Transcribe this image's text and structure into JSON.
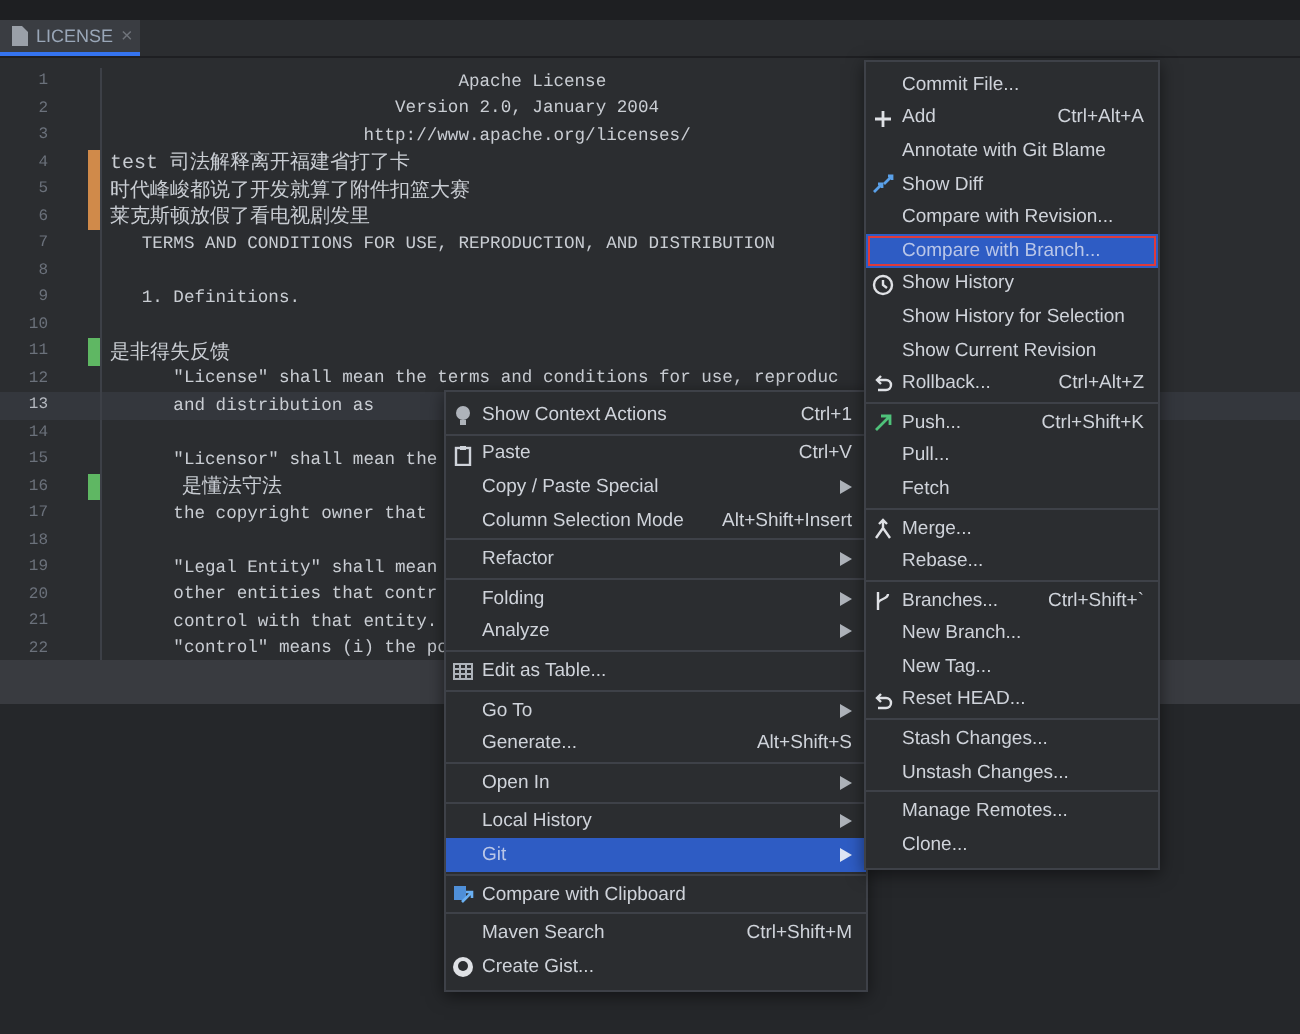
{
  "tab": {
    "label": "LICENSE",
    "close": "×",
    "selected": true
  },
  "editor": {
    "lines": [
      {
        "number": "1",
        "text": "                                 Apache License"
      },
      {
        "number": "2",
        "text": "                           Version 2.0, January 2004"
      },
      {
        "number": "3",
        "text": "                        http://www.apache.org/licenses/"
      },
      {
        "number": "4",
        "text": "test 司法解释离开福建省打了卡",
        "color": "#d08a4a"
      },
      {
        "number": "5",
        "text": "时代峰峻都说了开发就算了附件扣篮大赛",
        "color": "#d08a4a"
      },
      {
        "number": "6",
        "text": "莱克斯顿放假了看电视剧发里",
        "color": "#d08a4a"
      },
      {
        "number": "7",
        "text": "   TERMS AND CONDITIONS FOR USE, REPRODUCTION, AND DISTRIBUTION"
      },
      {
        "number": "8"
      },
      {
        "number": "9",
        "text": "   1. Definitions."
      },
      {
        "number": "10"
      },
      {
        "number": "11",
        "text": "是非得失反馈",
        "color": "#5fb763"
      },
      {
        "number": "12",
        "text": "      \"License\" shall mean the terms and conditions for use, reproduc"
      },
      {
        "number": "13",
        "text": "      and distribution as",
        "current": true
      },
      {
        "number": "14"
      },
      {
        "number": "15",
        "text": "      \"Licensor\" shall mean the"
      },
      {
        "number": "16",
        "text": "      是懂法守法",
        "color": "#5fb763"
      },
      {
        "number": "17",
        "text": "      the copyright owner that"
      },
      {
        "number": "18"
      },
      {
        "number": "19",
        "text": "      \"Legal Entity\" shall mean"
      },
      {
        "number": "20",
        "text": "      other entities that contr"
      },
      {
        "number": "21",
        "text": "      control with that entity."
      },
      {
        "number": "22",
        "text": "      \"control\" means (i) the po"
      }
    ]
  },
  "context_menu": {
    "items": [
      {
        "kind": "item",
        "label": "Show Context Actions",
        "shortcut": "Ctrl+1",
        "selected": false
      },
      {
        "kind": "separator"
      },
      {
        "kind": "item",
        "label": "Paste",
        "shortcut": "Ctrl+V",
        "selected": false
      },
      {
        "kind": "item",
        "label": "Copy / Paste Special",
        "submenu": true,
        "selected": false
      },
      {
        "kind": "item",
        "label": "Column Selection Mode",
        "shortcut": "Alt+Shift+Insert",
        "selected": false
      },
      {
        "kind": "separator"
      },
      {
        "kind": "item",
        "label": "Refactor",
        "submenu": true,
        "selected": false
      },
      {
        "kind": "separator"
      },
      {
        "kind": "item",
        "label": "Folding",
        "submenu": true,
        "selected": false
      },
      {
        "kind": "item",
        "label": "Analyze",
        "submenu": true,
        "selected": false
      },
      {
        "kind": "separator"
      },
      {
        "kind": "item",
        "label": "Edit as Table...",
        "selected": false
      },
      {
        "kind": "separator"
      },
      {
        "kind": "item",
        "label": "Go To",
        "submenu": true,
        "selected": false
      },
      {
        "kind": "item",
        "label": "Generate...",
        "shortcut": "Alt+Shift+S",
        "selected": false
      },
      {
        "kind": "separator"
      },
      {
        "kind": "item",
        "label": "Open In",
        "submenu": true,
        "selected": false
      },
      {
        "kind": "separator"
      },
      {
        "kind": "item",
        "label": "Local History",
        "submenu": true,
        "selected": false
      },
      {
        "kind": "item",
        "label": "Git",
        "submenu": true,
        "selected": true
      },
      {
        "kind": "separator"
      },
      {
        "kind": "item",
        "label": "Compare with Clipboard",
        "selected": false
      },
      {
        "kind": "separator"
      },
      {
        "kind": "item",
        "label": "Maven Search",
        "shortcut": "Ctrl+Shift+M",
        "selected": false
      },
      {
        "kind": "item",
        "label": "Create Gist...",
        "selected": false
      }
    ]
  },
  "git_submenu": {
    "items": [
      {
        "kind": "item",
        "label": "Commit File...",
        "selected": false
      },
      {
        "kind": "item",
        "label": "Add",
        "shortcut": "Ctrl+Alt+A",
        "selected": false
      },
      {
        "kind": "item",
        "label": "Annotate with Git Blame",
        "selected": false
      },
      {
        "kind": "item",
        "label": "Show Diff",
        "selected": false
      },
      {
        "kind": "item",
        "label": "Compare with Revision...",
        "selected": false
      },
      {
        "kind": "item",
        "label": "Compare with Branch...",
        "selected": true,
        "outlined": true
      },
      {
        "kind": "item",
        "label": "Show History",
        "selected": false
      },
      {
        "kind": "item",
        "label": "Show History for Selection",
        "selected": false
      },
      {
        "kind": "item",
        "label": "Show Current Revision",
        "selected": false
      },
      {
        "kind": "item",
        "label": "Rollback...",
        "shortcut": "Ctrl+Alt+Z",
        "selected": false
      },
      {
        "kind": "separator"
      },
      {
        "kind": "item",
        "label": "Push...",
        "shortcut": "Ctrl+Shift+K",
        "selected": false
      },
      {
        "kind": "item",
        "label": "Pull...",
        "selected": false
      },
      {
        "kind": "item",
        "label": "Fetch",
        "selected": false
      },
      {
        "kind": "separator"
      },
      {
        "kind": "item",
        "label": "Merge...",
        "selected": false
      },
      {
        "kind": "item",
        "label": "Rebase...",
        "selected": false
      },
      {
        "kind": "separator"
      },
      {
        "kind": "item",
        "label": "Branches...",
        "shortcut": "Ctrl+Shift+`",
        "selected": false
      },
      {
        "kind": "item",
        "label": "New Branch...",
        "selected": false
      },
      {
        "kind": "item",
        "label": "New Tag...",
        "selected": false
      },
      {
        "kind": "item",
        "label": "Reset HEAD...",
        "selected": false
      },
      {
        "kind": "separator"
      },
      {
        "kind": "item",
        "label": "Stash Changes...",
        "selected": false
      },
      {
        "kind": "item",
        "label": "Unstash Changes...",
        "selected": false
      },
      {
        "kind": "separator"
      },
      {
        "kind": "item",
        "label": "Manage Remotes...",
        "selected": false
      },
      {
        "kind": "item",
        "label": "Clone...",
        "selected": false
      }
    ]
  }
}
